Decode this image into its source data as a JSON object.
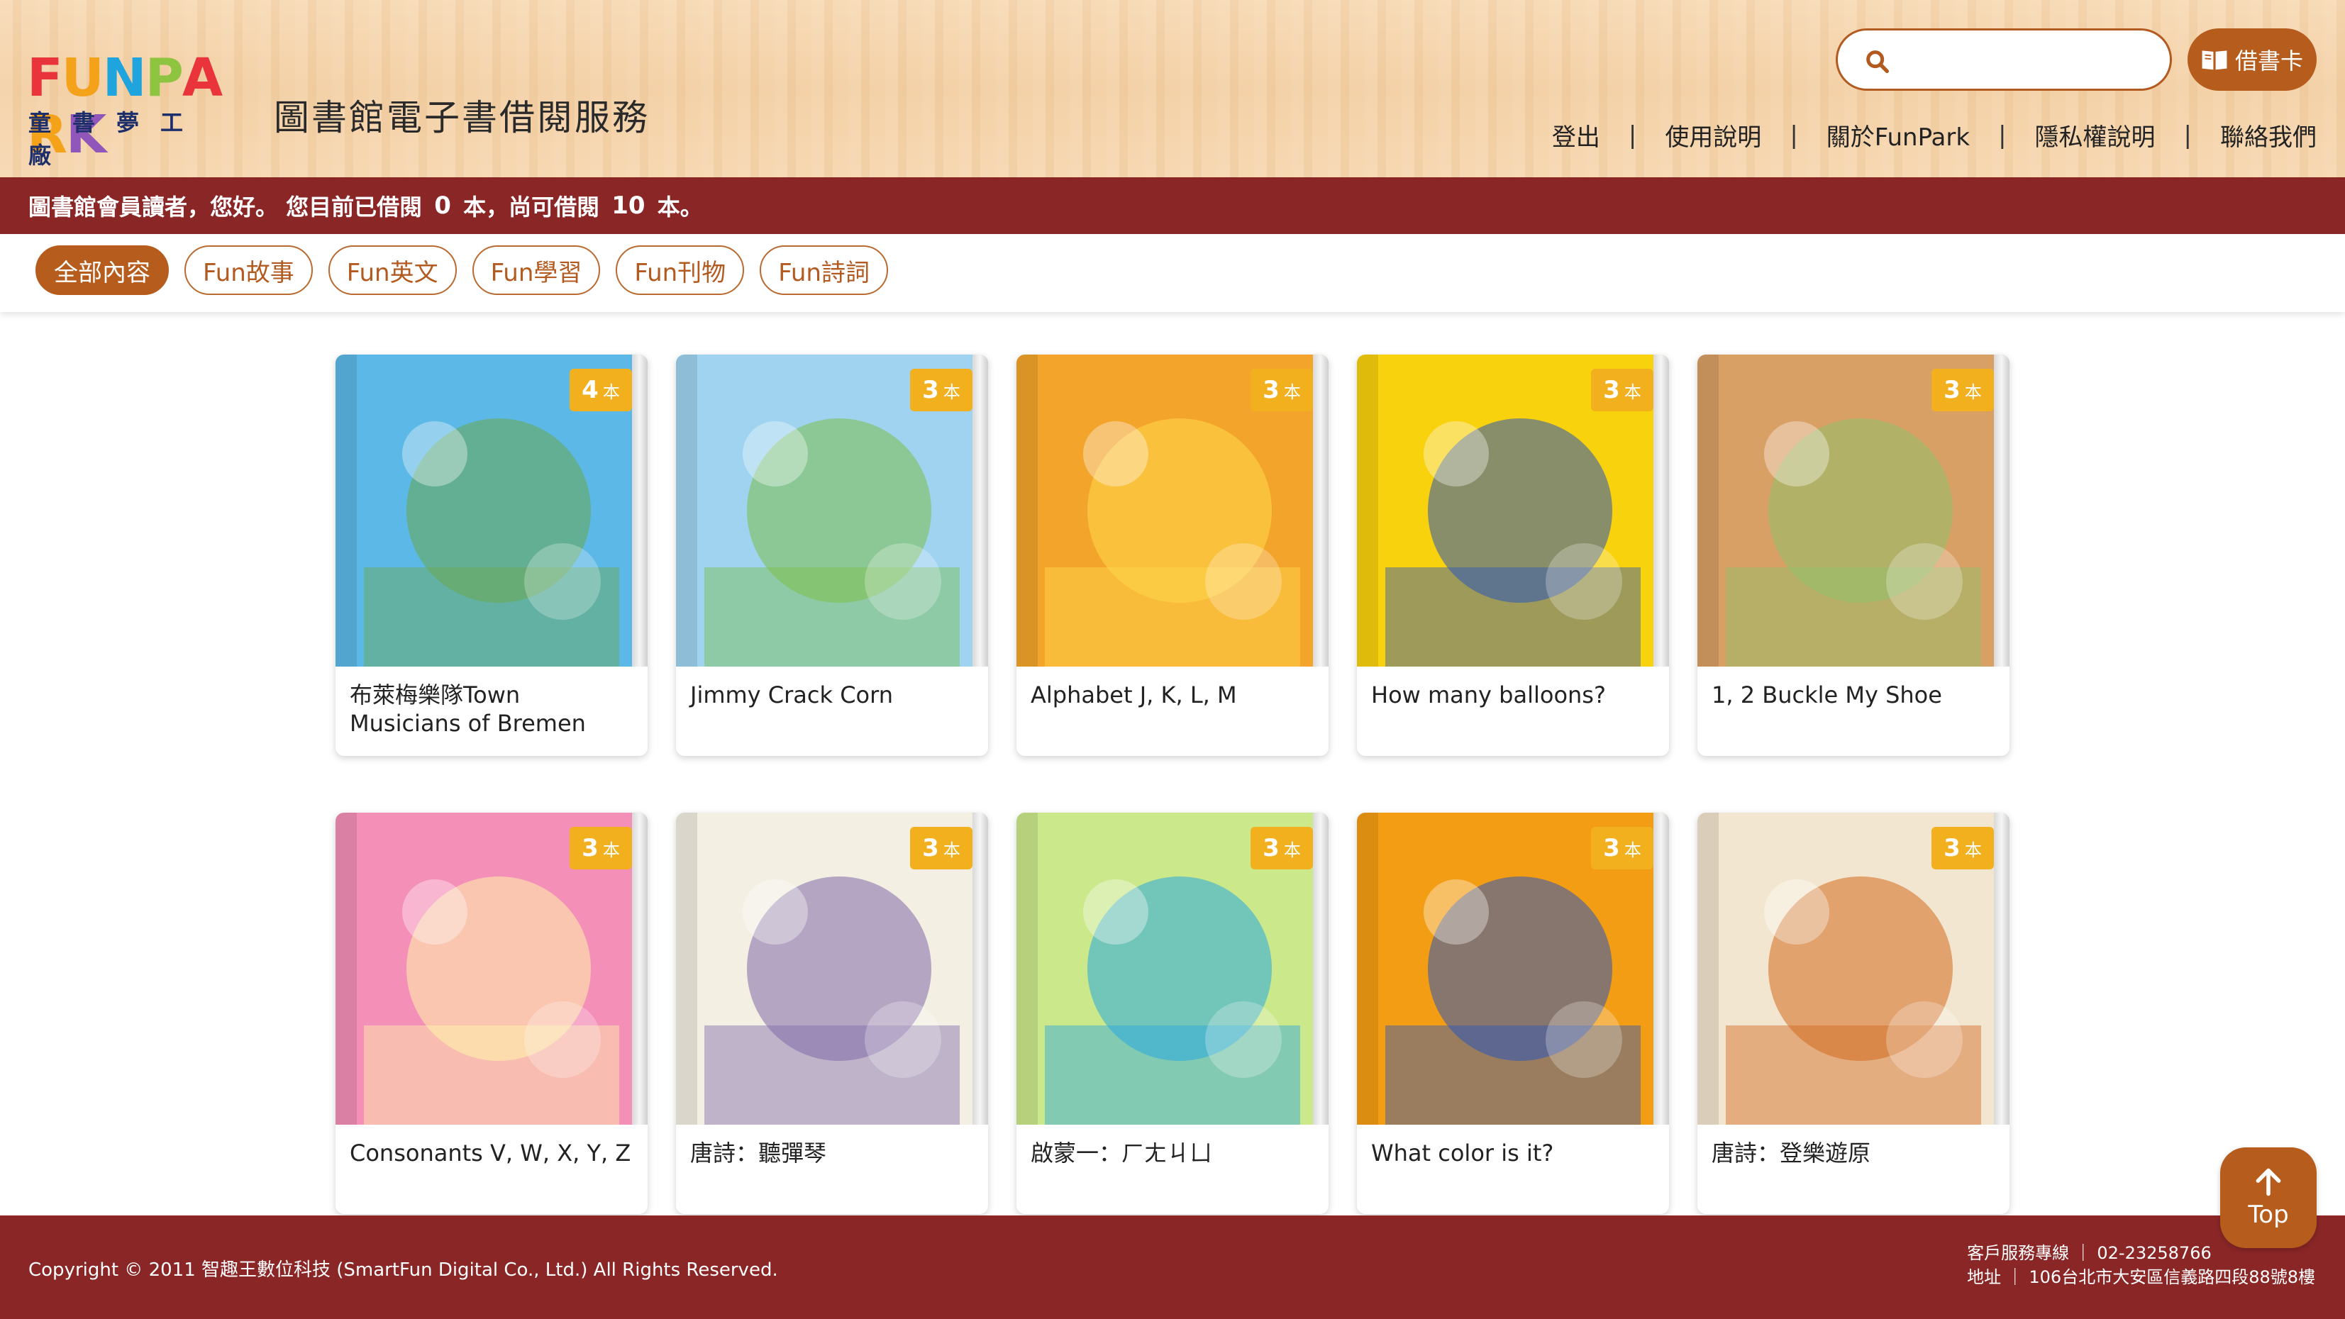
{
  "brand": {
    "logo_word": "FUNPARK",
    "logo_subtitle": "童書夢工廠",
    "site_title": "圖書館電子書借閱服務"
  },
  "search": {
    "placeholder": "",
    "value": ""
  },
  "library_card_button": {
    "label": "借書卡",
    "icon": "book-icon"
  },
  "nav": {
    "logout": "登出",
    "help": "使用說明",
    "about": "關於FunPark",
    "privacy": "隱私權說明",
    "contact": "聯絡我們",
    "separator": "|"
  },
  "status": {
    "greeting": "圖書館會員讀者，您好。 您目前已借閱 ",
    "borrowed": "0",
    "middle": " 本，尚可借閱 ",
    "remaining": "10",
    "end": " 本。"
  },
  "filters": [
    "全部內容",
    "Fun故事",
    "Fun英文",
    "Fun學習",
    "Fun刊物",
    "Fun詩詞"
  ],
  "active_filter": "全部內容",
  "badge_unit": "本",
  "books": [
    {
      "title": "布萊梅樂隊Town Musicians of Bremen",
      "copies": "4",
      "cover_color": "#5cb8e6",
      "cover_accent": "#6aa84f"
    },
    {
      "title": "Jimmy Crack Corn",
      "copies": "3",
      "cover_color": "#9fd3f0",
      "cover_accent": "#7bbf4a"
    },
    {
      "title": "Alphabet J, K, L, M",
      "copies": "3",
      "cover_color": "#f3a52b",
      "cover_accent": "#ffd84d"
    },
    {
      "title": "How many balloons?",
      "copies": "3",
      "cover_color": "#f9d20e",
      "cover_accent": "#2d56b7"
    },
    {
      "title": "1, 2 Buckle My Shoe",
      "copies": "3",
      "cover_color": "#d9a066",
      "cover_accent": "#8fc16a"
    },
    {
      "title": "Consonants V, W, X, Y, Z",
      "copies": "3",
      "cover_color": "#f48fb8",
      "cover_accent": "#fff4a8"
    },
    {
      "title": "唐詩：聽彈琴",
      "copies": "3",
      "cover_color": "#f3efe3",
      "cover_accent": "#7f6aa8"
    },
    {
      "title": "啟蒙一：ㄏㄤㄐㄩ",
      "copies": "3",
      "cover_color": "#cbe88a",
      "cover_accent": "#2aa7e0"
    },
    {
      "title": "What color is it?",
      "copies": "3",
      "cover_color": "#f39d14",
      "cover_accent": "#2d56b7"
    },
    {
      "title": "唐詩：登樂遊原",
      "copies": "3",
      "cover_color": "#f3e6d0",
      "cover_accent": "#d2691e"
    }
  ],
  "footer": {
    "copyright": "Copyright © 2011 智趣王數位科技 (SmartFun Digital Co., Ltd.) All Rights Reserved.",
    "service_line": "客戶服務專線 ｜ 02-23258766",
    "address": "地址 ｜ 106台北市大安區信義路四段88號8樓"
  },
  "top_button": {
    "label": "Top",
    "icon": "arrow-up-icon"
  },
  "colors": {
    "brand_brown": "#b65c1c",
    "status_bar_red": "#8b2627",
    "badge_yellow": "#f2b01e"
  }
}
